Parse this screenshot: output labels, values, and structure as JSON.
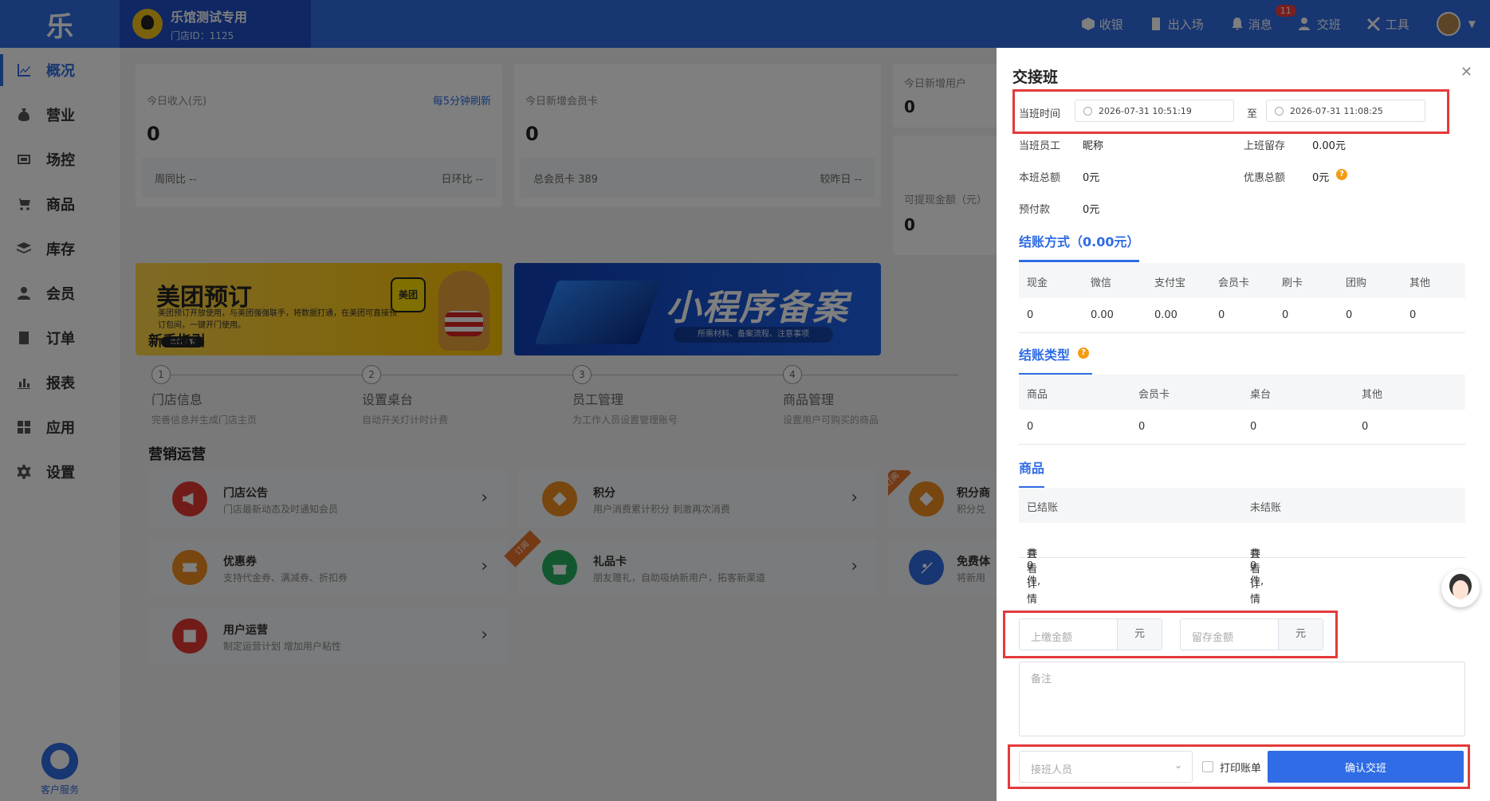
{
  "app": {
    "logo_text": "乐"
  },
  "store": {
    "name": "乐馆测试专用",
    "id_text": "门店ID：1125"
  },
  "topnav": {
    "items": [
      {
        "label": "收银"
      },
      {
        "label": "出入场"
      },
      {
        "label": "消息",
        "badge": "11"
      },
      {
        "label": "交班"
      },
      {
        "label": "工具"
      }
    ]
  },
  "sidebar": {
    "items": [
      {
        "label": "概况"
      },
      {
        "label": "营业"
      },
      {
        "label": "场控"
      },
      {
        "label": "商品"
      },
      {
        "label": "库存"
      },
      {
        "label": "会员"
      },
      {
        "label": "订单"
      },
      {
        "label": "报表"
      },
      {
        "label": "应用"
      },
      {
        "label": "设置"
      }
    ],
    "customer_service": "客户服务"
  },
  "stats": {
    "income": {
      "title": "今日收入(元)",
      "refresh": "每5分钟刷新",
      "value": "0",
      "left": "周同比 --",
      "right": "日环比 --"
    },
    "members": {
      "title": "今日新增会员卡",
      "value": "0",
      "left": "总会员卡 389",
      "right": "较昨日 --"
    },
    "users": {
      "title": "今日新增用户",
      "value": "0"
    },
    "withdraw": {
      "title": "可提现金额（元）",
      "value": "0"
    }
  },
  "banners": {
    "meituan": {
      "title": "美团预订",
      "desc": "美团预订开放使用，与美团强强联手，将数据打通，在美团可直接预订包间，一键开门使用。",
      "button": "点击了解",
      "logo": "美团"
    },
    "miniprogram": {
      "title": "小程序备案",
      "sub": "所需材料、备案流程、注意事项"
    }
  },
  "guide": {
    "title": "新手指引",
    "steps": [
      {
        "num": "1",
        "title": "门店信息",
        "desc": "完善信息并生成门店主页"
      },
      {
        "num": "2",
        "title": "设置桌台",
        "desc": "自动开关灯计时计费"
      },
      {
        "num": "3",
        "title": "员工管理",
        "desc": "为工作人员设置管理账号"
      },
      {
        "num": "4",
        "title": "商品管理",
        "desc": "设置用户可购买的商品"
      }
    ]
  },
  "marketing": {
    "title": "营销运营",
    "items": [
      {
        "title": "门店公告",
        "desc": "门店最新动态及时通知会员",
        "color": "#e53935"
      },
      {
        "title": "积分",
        "desc": "用户消费累计积分 刺激再次消费",
        "color": "#f08c1f"
      },
      {
        "title": "积分商",
        "desc": "积分兑",
        "color": "#f08c1f",
        "ribbon": "订阅"
      },
      {
        "title": "优惠券",
        "desc": "支持代金券、满减券、折扣券",
        "color": "#f08c1f"
      },
      {
        "title": "礼品卡",
        "desc": "朋友赠礼，自助吸纳新用户，拓客新渠道",
        "color": "#27ae60",
        "ribbon": "订阅"
      },
      {
        "title": "免费体",
        "desc": "将新用",
        "color": "#2f6ce5"
      },
      {
        "title": "用户运营",
        "desc": "制定运营计划 增加用户粘性",
        "color": "#e53935"
      }
    ]
  },
  "handover": {
    "title": "交接班",
    "time_label": "当班时间",
    "start_time": "2026-07-31 10:51:19",
    "to": "至",
    "end_time": "2026-07-31 11:08:25",
    "staff_label": "当班员工",
    "staff_value": "昵称",
    "prev_label": "上班留存",
    "prev_value": "0.00元",
    "total_label": "本班总额",
    "total_value": "0元",
    "discount_label": "优惠总额",
    "discount_value": "0元",
    "prepay_label": "预付款",
    "prepay_value": "0元",
    "payment": {
      "head": "结账方式（0.00元）",
      "columns": [
        "现金",
        "微信",
        "支付宝",
        "会员卡",
        "刷卡",
        "团购",
        "其他"
      ],
      "values": [
        "0",
        "0.00",
        "0.00",
        "0",
        "0",
        "0",
        "0"
      ]
    },
    "types": {
      "head": "结账类型",
      "columns": [
        "商品",
        "会员卡",
        "桌台",
        "其他"
      ],
      "values": [
        "0",
        "0",
        "0",
        "0"
      ]
    },
    "goods": {
      "head": "商品",
      "columns": [
        "已结账",
        "未结账"
      ],
      "settled_count": "共0件,",
      "unsettled_count": "共0件,",
      "detail_link": "查看详情"
    },
    "submit_placeholder": "上缴金额",
    "retain_placeholder": "留存金额",
    "unit": "元",
    "remark_placeholder": "备注",
    "successor_placeholder": "接班人员",
    "print_label": "打印账单",
    "confirm_label": "确认交班"
  }
}
